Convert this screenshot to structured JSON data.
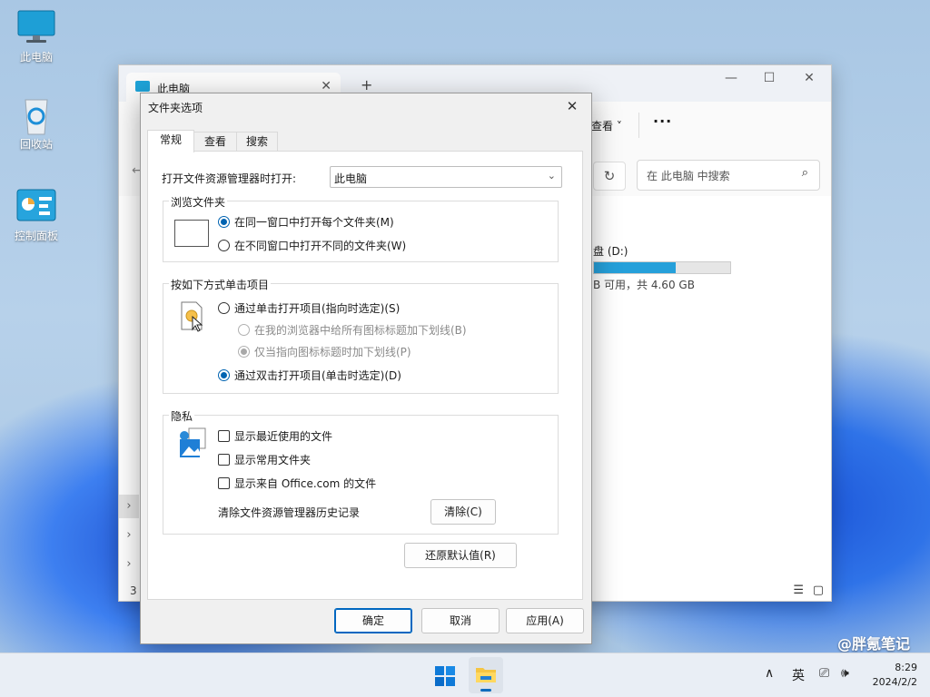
{
  "desktop": {
    "icons": [
      {
        "label": "此电脑"
      },
      {
        "label": "回收站"
      },
      {
        "label": "控制面板"
      }
    ]
  },
  "explorer": {
    "tab_title": "此电脑",
    "new_tab": "+",
    "toolbar": {
      "view": "查看",
      "more": "···"
    },
    "search_placeholder": "在 此电脑 中搜索",
    "drive": {
      "label": "盘 (D:)",
      "free_text": "B 可用，共 4.60 GB",
      "used_fraction": 0.6
    },
    "status_count": "3"
  },
  "dialog": {
    "title": "文件夹选项",
    "close": "✕",
    "tabs": [
      "常规",
      "查看",
      "搜索"
    ],
    "open_explorer_label": "打开文件资源管理器时打开:",
    "open_explorer_value": "此电脑",
    "browse": {
      "title": "浏览文件夹",
      "same_window": "在同一窗口中打开每个文件夹(M)",
      "new_window": "在不同窗口中打开不同的文件夹(W)"
    },
    "click": {
      "title": "按如下方式单击项目",
      "single": "通过单击打开项目(指向时选定)(S)",
      "underline_browser": "在我的浏览器中给所有图标标题加下划线(B)",
      "underline_point": "仅当指向图标标题时加下划线(P)",
      "double": "通过双击打开项目(单击时选定)(D)"
    },
    "privacy": {
      "title": "隐私",
      "recent_files": "显示最近使用的文件",
      "frequent_folders": "显示常用文件夹",
      "office_files": "显示来自 Office.com 的文件",
      "clear_label": "清除文件资源管理器历史记录",
      "clear_button": "清除(C)"
    },
    "restore_defaults": "还原默认值(R)",
    "ok": "确定",
    "cancel": "取消",
    "apply": "应用(A)"
  },
  "taskbar": {
    "ime": "英",
    "time": "8:29",
    "date": "2024/2/2"
  },
  "watermark": "@胖氪笔记"
}
